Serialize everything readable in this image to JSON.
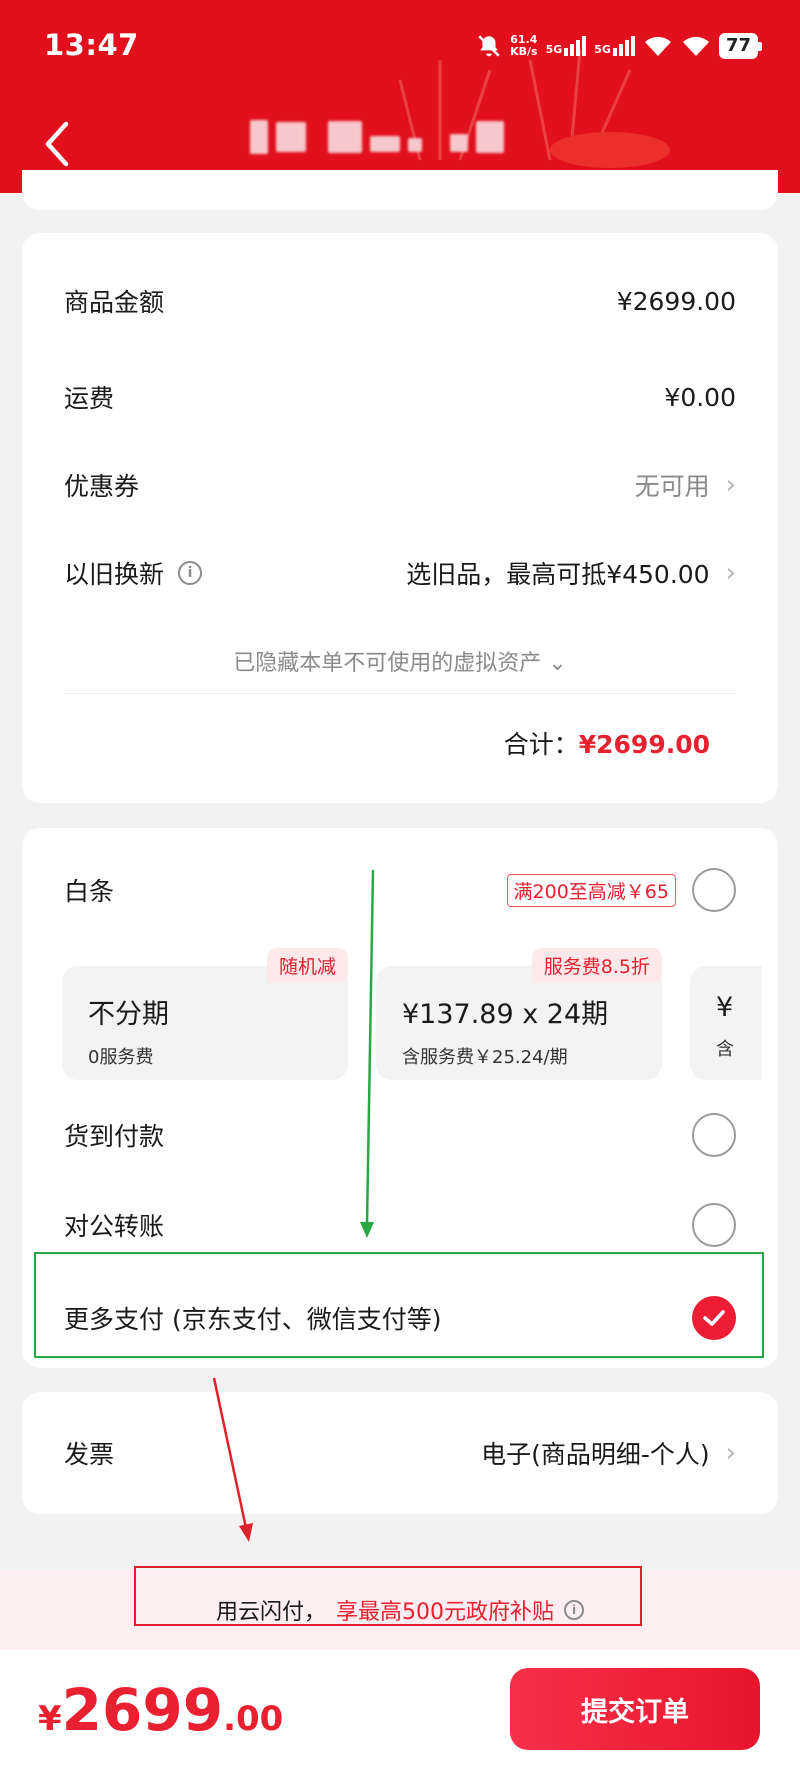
{
  "status_bar": {
    "time": "13:47",
    "speed_value": "61.4",
    "speed_unit": "KB/s",
    "net1": "5G",
    "net2": "5G",
    "battery": "77"
  },
  "summary": {
    "goods_label": "商品金额",
    "goods_value": "¥2699.00",
    "shipping_label": "运费",
    "shipping_value": "¥0.00",
    "coupon_label": "优惠券",
    "coupon_value": "无可用",
    "tradein_label": "以旧换新",
    "tradein_value": "选旧品，最高可抵¥450.00",
    "hidden_note": "已隐藏本单不可使用的虚拟资产",
    "total_label": "合计：",
    "total_value": "¥2699.00"
  },
  "payment": {
    "baitiao_label": "白条",
    "baitiao_promo": "满200至高减￥65",
    "plans": [
      {
        "main": "不分期",
        "sub": "0服务费",
        "badge": "随机减"
      },
      {
        "main": "¥137.89 x 24期",
        "sub": "含服务费￥25.24/期",
        "badge": "服务费8.5折"
      },
      {
        "main": "¥",
        "sub": "含",
        "badge": ""
      }
    ],
    "cod_label": "货到付款",
    "transfer_label": "对公转账",
    "more_label": "更多支付 (京东支付、微信支付等)"
  },
  "invoice": {
    "label": "发票",
    "value": "电子(商品明细-个人)"
  },
  "subsidy": {
    "plain": "用云闪付，",
    "red": "享最高500元政府补贴"
  },
  "footer": {
    "yen": "¥",
    "price_int": "2699",
    "price_dec": ".00",
    "submit_label": "提交订单"
  },
  "colors": {
    "brand_red": "#e1101c",
    "accent_red": "#e8202f",
    "annotation_green": "#28a745"
  },
  "icons": [
    "back-chevron-icon",
    "info-icon",
    "chevron-right-icon",
    "chevron-down-icon",
    "check-icon",
    "signal-icon",
    "wifi-icon",
    "mute-bell-icon"
  ]
}
